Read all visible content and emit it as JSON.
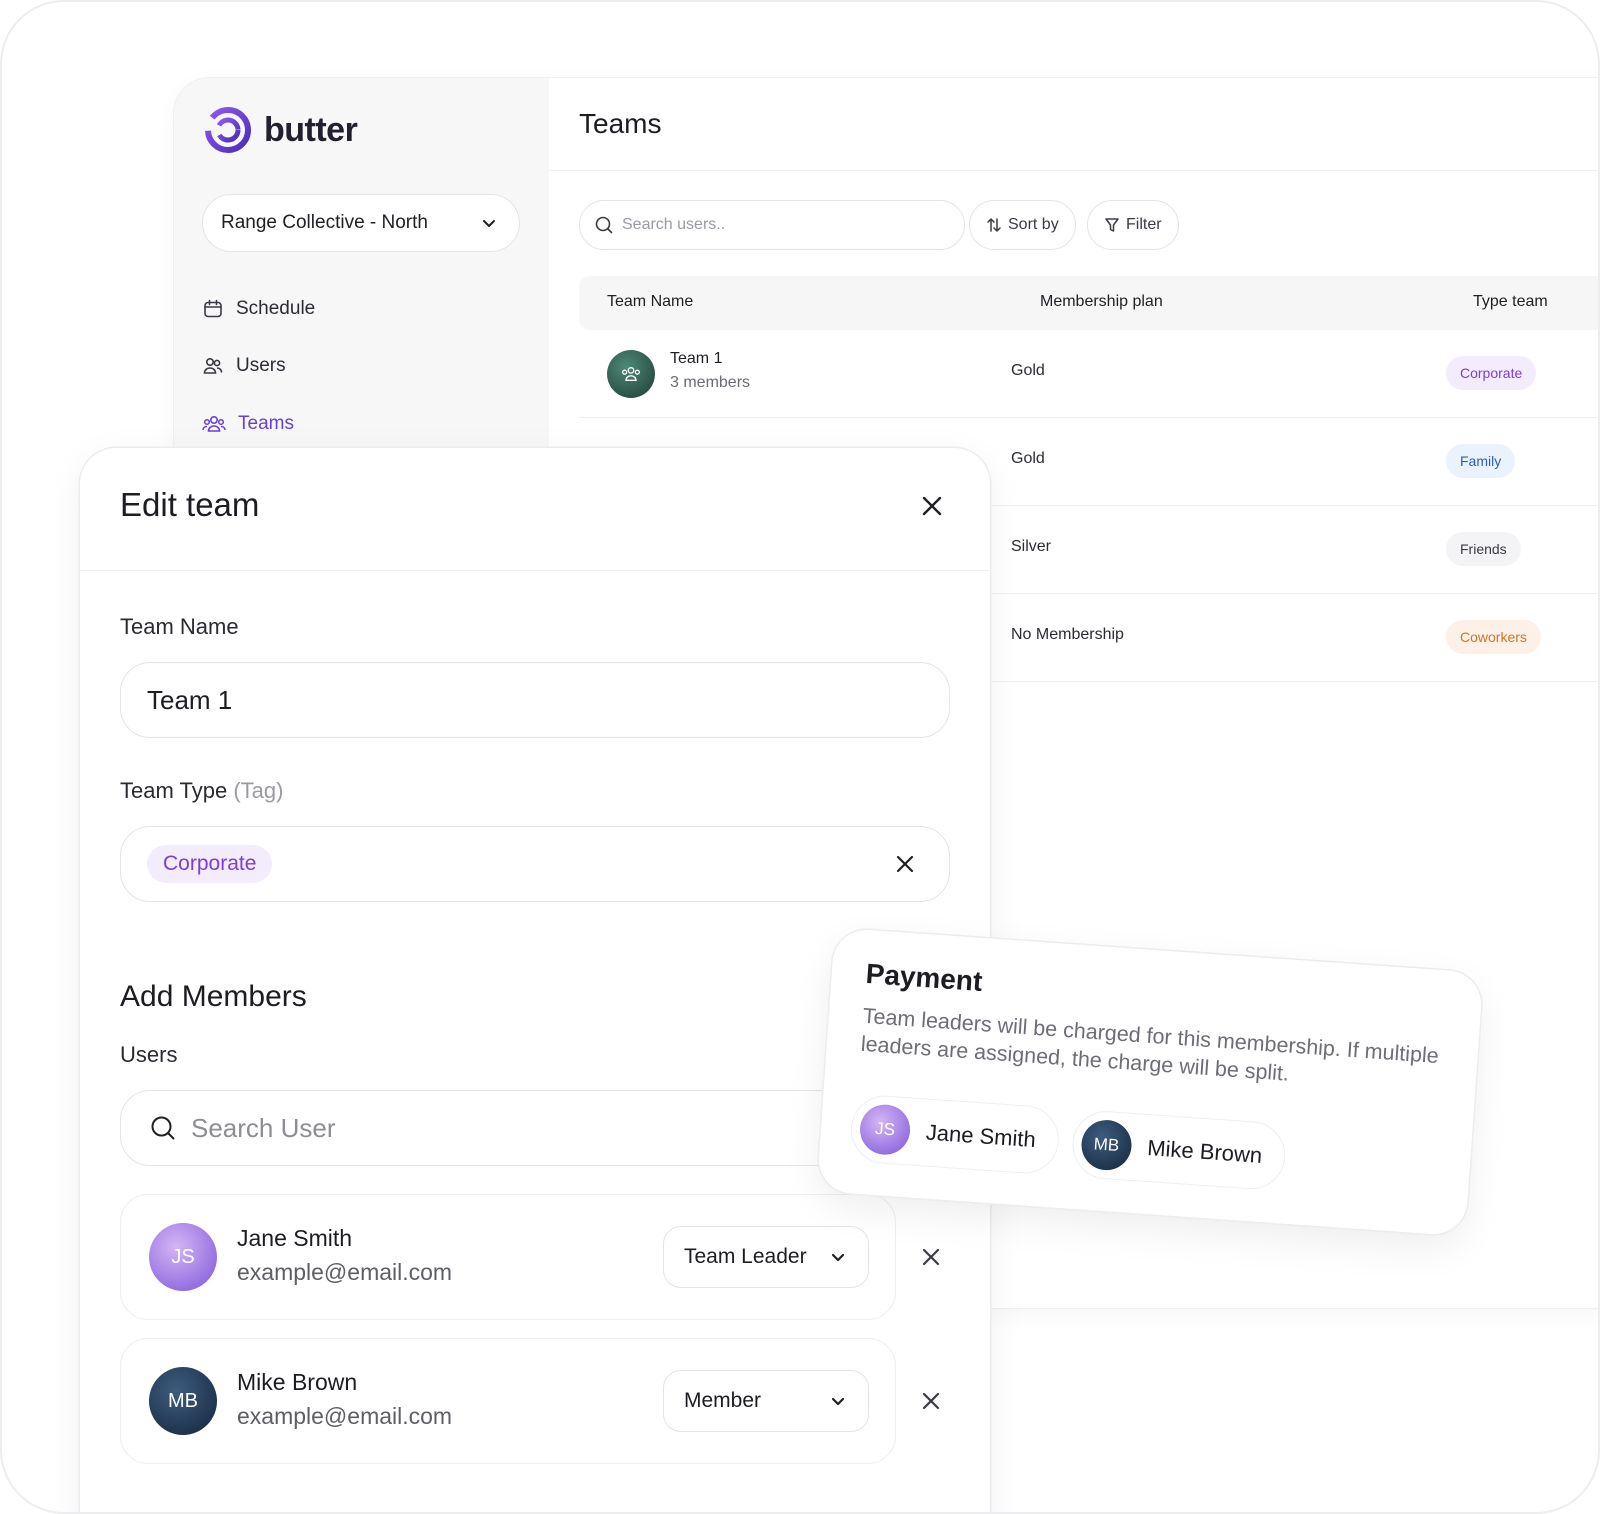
{
  "brand": {
    "name": "butter",
    "accent": "#6a3fd6"
  },
  "sidebar": {
    "location": "Range Collective - North",
    "items": [
      {
        "label": "Schedule",
        "icon": "calendar-icon"
      },
      {
        "label": "Users",
        "icon": "users-icon"
      },
      {
        "label": "Teams",
        "icon": "teams-icon",
        "active": true
      }
    ]
  },
  "main": {
    "title": "Teams",
    "search_placeholder": "Search users..",
    "sort_label": "Sort by",
    "filter_label": "Filter",
    "columns": [
      "Team Name",
      "Membership plan",
      "Type team"
    ],
    "rows": [
      {
        "name": "Team 1",
        "members": "3 members",
        "plan": "Gold",
        "type": "Corporate",
        "type_color": "#7b3fd6",
        "type_bg": "#f3ecfd"
      },
      {
        "name": "",
        "members": "",
        "plan": "Gold",
        "type": "Family",
        "type_color": "#2d5fb0",
        "type_bg": "#eaf2fd"
      },
      {
        "name": "",
        "members": "",
        "plan": "Silver",
        "type": "Friends",
        "type_color": "#3a3a44",
        "type_bg": "#f4f4f6"
      },
      {
        "name": "",
        "members": "",
        "plan": "No Membership",
        "type": "Coworkers",
        "type_color": "#d0752e",
        "type_bg": "#fdf1e7"
      }
    ]
  },
  "modal": {
    "title": "Edit team",
    "team_name_label": "Team Name",
    "team_name_value": "Team 1",
    "team_type_label": "Team Type",
    "team_type_hint": "(Tag)",
    "team_type_tag": "Corporate",
    "add_members_title": "Add Members",
    "users_label": "Users",
    "search_user_placeholder": "Search User",
    "members": [
      {
        "initials": "JS",
        "name": "Jane Smith",
        "email": "example@email.com",
        "role": "Team Leader"
      },
      {
        "initials": "MB",
        "name": "Mike Brown",
        "email": "example@email.com",
        "role": "Member"
      }
    ]
  },
  "payment": {
    "title": "Payment",
    "text": "Team leaders will be charged for this membership. If multiple leaders are assigned, the charge will be split.",
    "users": [
      {
        "initials": "JS",
        "name": "Jane Smith"
      },
      {
        "initials": "MB",
        "name": "Mike Brown"
      }
    ]
  }
}
